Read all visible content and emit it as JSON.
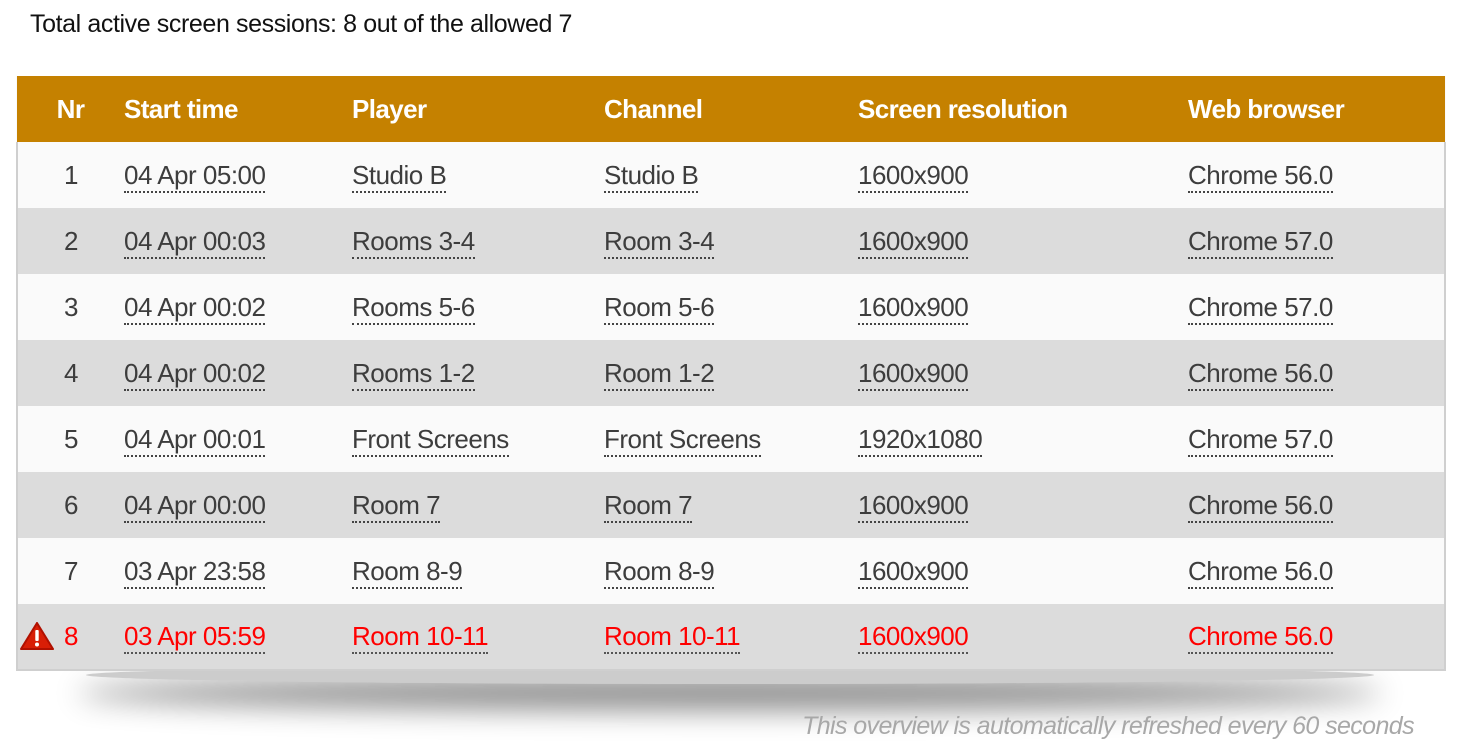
{
  "summary": {
    "text": "Total active screen sessions: 8 out of the allowed 7"
  },
  "table": {
    "headers": {
      "nr": "Nr",
      "start_time": "Start time",
      "player": "Player",
      "channel": "Channel",
      "screen_resolution": "Screen resolution",
      "web_browser": "Web browser"
    },
    "rows": [
      {
        "nr": "1",
        "start_time": "04 Apr 05:00",
        "player": "Studio B",
        "channel": "Studio B",
        "screen_resolution": "1600x900",
        "web_browser": "Chrome 56.0"
      },
      {
        "nr": "2",
        "start_time": "04 Apr 00:03",
        "player": "Rooms 3-4",
        "channel": "Room 3-4",
        "screen_resolution": "1600x900",
        "web_browser": "Chrome 57.0"
      },
      {
        "nr": "3",
        "start_time": "04 Apr 00:02",
        "player": "Rooms 5-6",
        "channel": "Room 5-6",
        "screen_resolution": "1600x900",
        "web_browser": "Chrome 57.0"
      },
      {
        "nr": "4",
        "start_time": "04 Apr 00:02",
        "player": "Rooms 1-2",
        "channel": "Room 1-2",
        "screen_resolution": "1600x900",
        "web_browser": "Chrome 56.0"
      },
      {
        "nr": "5",
        "start_time": "04 Apr 00:01",
        "player": "Front Screens",
        "channel": "Front Screens",
        "screen_resolution": "1920x1080",
        "web_browser": "Chrome 57.0"
      },
      {
        "nr": "6",
        "start_time": "04 Apr 00:00",
        "player": "Room 7",
        "channel": "Room 7",
        "screen_resolution": "1600x900",
        "web_browser": "Chrome 56.0"
      },
      {
        "nr": "7",
        "start_time": "03 Apr 23:58",
        "player": "Room 8-9",
        "channel": "Room 8-9",
        "screen_resolution": "1600x900",
        "web_browser": "Chrome 56.0"
      },
      {
        "nr": "8",
        "start_time": "03 Apr 05:59",
        "player": "Room 10-11",
        "channel": "Room 10-11",
        "screen_resolution": "1600x900",
        "web_browser": "Chrome 56.0",
        "alert": true,
        "alert_icon": "warning-triangle-icon"
      }
    ]
  },
  "colors": {
    "header_bg": "#c58100",
    "alert_text": "#ff0000",
    "row_alt_bg": "#dcdcdc"
  },
  "footer": {
    "note": "This overview is automatically refreshed every 60 seconds"
  }
}
